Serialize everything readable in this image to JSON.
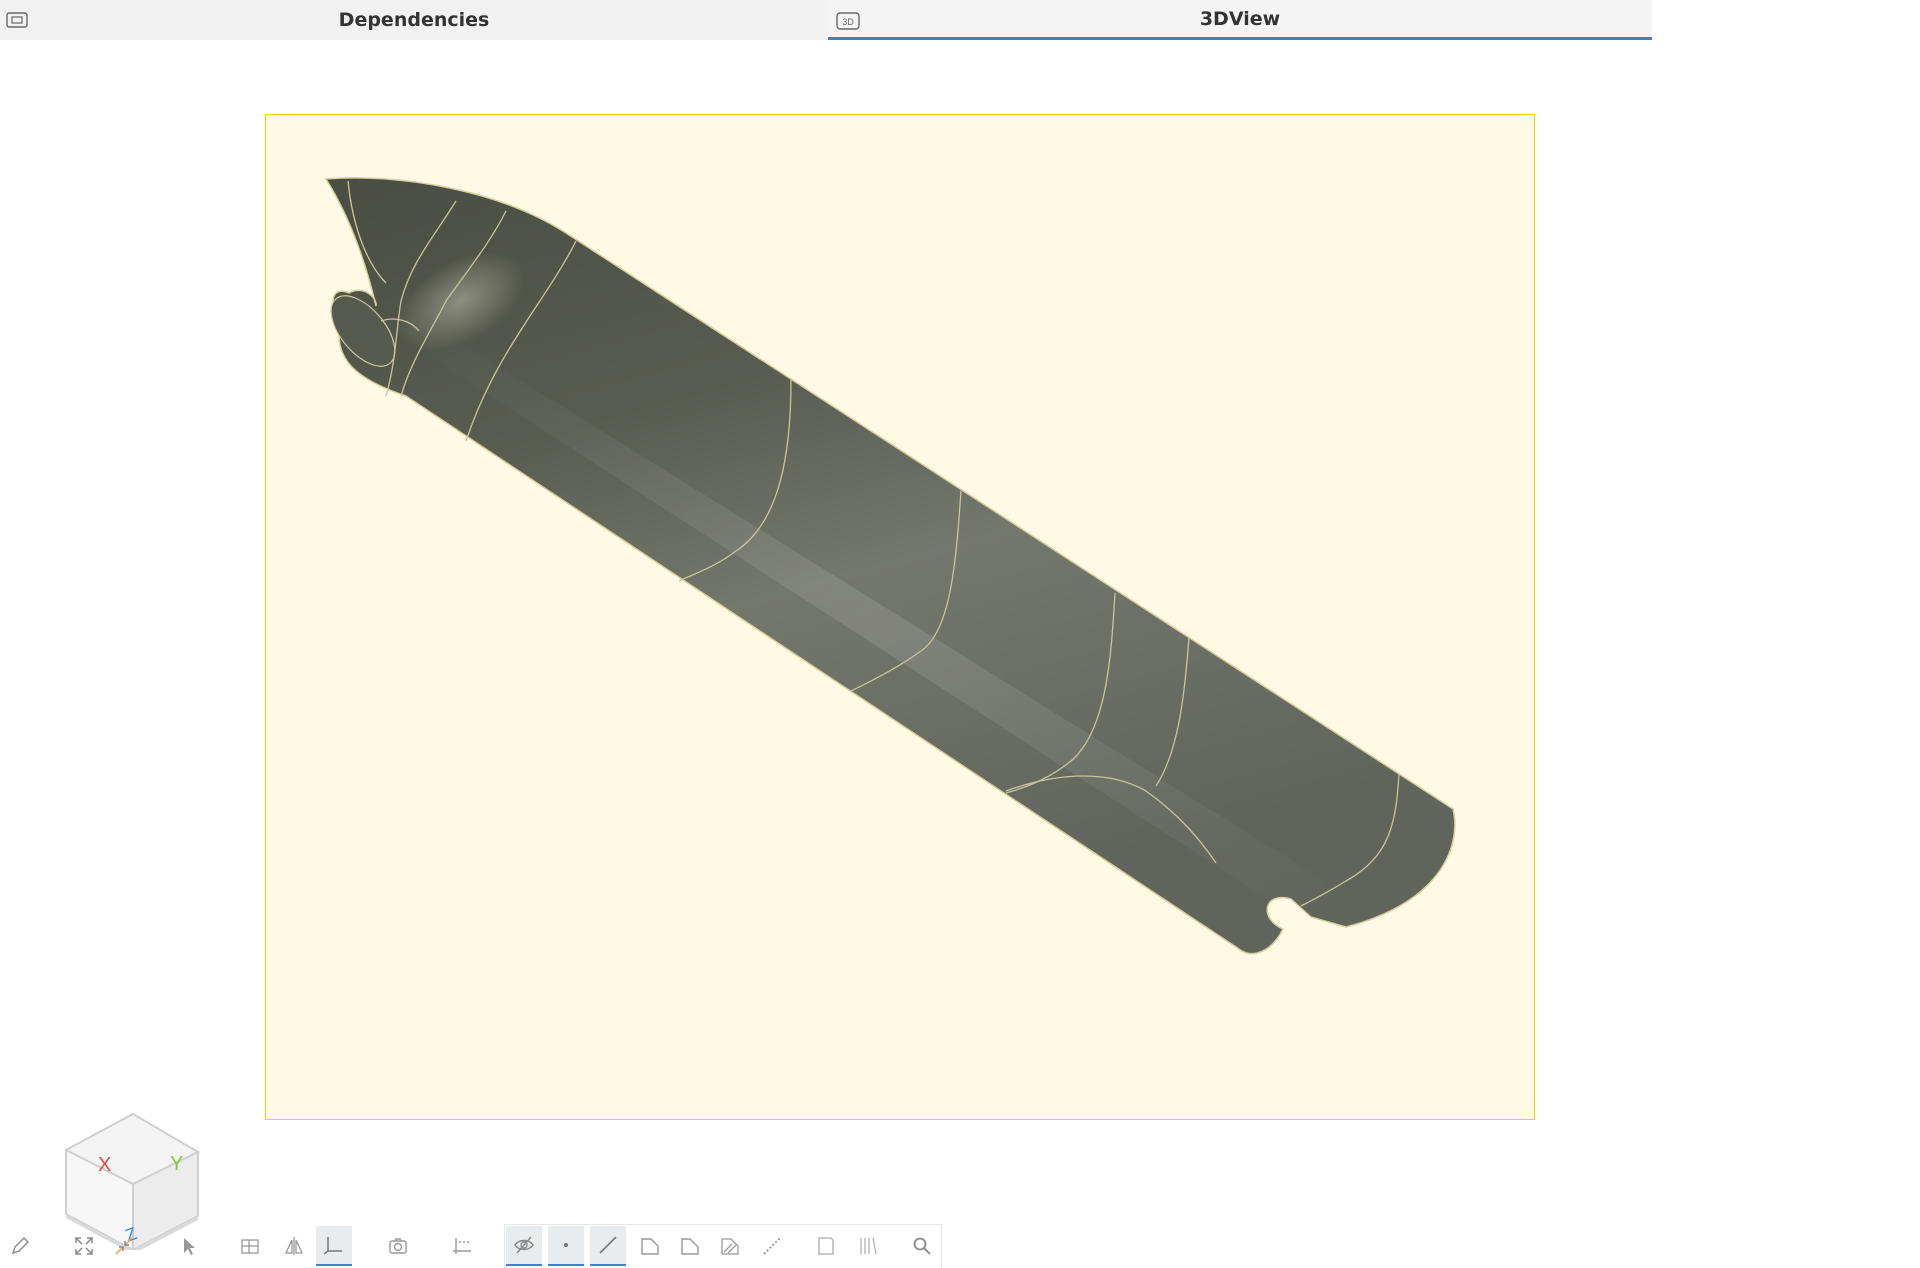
{
  "tabs": [
    {
      "label": "Dependencies",
      "icon": "panel-icon",
      "active": false
    },
    {
      "label": "3DView",
      "icon": "3d-view-icon",
      "icon_text": "3D",
      "active": true
    }
  ],
  "navcube": {
    "x_label": "X",
    "y_label": "Y",
    "z_label": "Z"
  },
  "toolbar": [
    {
      "name": "sketch-pencil-icon",
      "active": false
    },
    {
      "name": "fit-all-icon",
      "active": false
    },
    {
      "name": "fit-selection-icon",
      "active": false
    },
    {
      "name": "select-arrow-icon",
      "active": false
    },
    {
      "name": "grid-view-icon",
      "active": false
    },
    {
      "name": "mirror-icon",
      "active": false
    },
    {
      "name": "axis-icon",
      "active": true
    },
    {
      "name": "camera-icon",
      "active": false
    },
    {
      "name": "dimension-icon",
      "active": false
    },
    {
      "name": "hide-icon",
      "active": true
    },
    {
      "name": "vertex-icon",
      "active": true
    },
    {
      "name": "edge-icon",
      "active": true
    },
    {
      "name": "face-icon",
      "active": false
    },
    {
      "name": "face-shaded-icon",
      "active": false
    },
    {
      "name": "face-hatched-icon",
      "active": false
    },
    {
      "name": "dotted-line-icon",
      "active": false
    },
    {
      "name": "section-icon",
      "active": false
    },
    {
      "name": "stripes-icon",
      "active": false
    },
    {
      "name": "search-icon",
      "active": false
    }
  ],
  "colors": {
    "accent": "#3f7fd2",
    "viewport_background": "#fff9e6",
    "frame_border": "#f0d400",
    "model_surface": "#5f6357",
    "model_edges": "#c8c4a0",
    "x_axis": "#e04a4a",
    "y_axis": "#8ac43c",
    "z_axis": "#3a8fe0"
  }
}
